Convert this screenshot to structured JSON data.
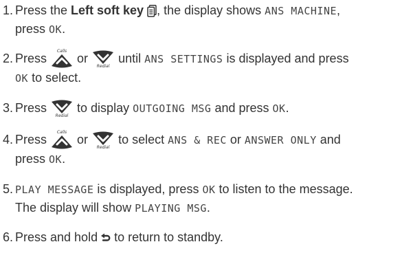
{
  "steps": [
    {
      "num": "1.",
      "t1": "Press the ",
      "bold": "Left soft key",
      "t2": ", the display shows ",
      "lcd1": "ANS MACHINE",
      "t3": ",",
      "t4": "press ",
      "lcd2": "OK",
      "t5": ".",
      "icon": "phonebook-soft-key-icon"
    },
    {
      "num": "2.",
      "t1": "Press ",
      "t2": " or ",
      "t3": " until ",
      "lcd1": "ANS SETTINGS",
      "t4": " is displayed and press",
      "lcd2": "OK",
      "t5": " to select.",
      "icons": [
        "calls-up-icon",
        "redial-down-icon"
      ]
    },
    {
      "num": "3.",
      "t1": "Press ",
      "t2": " to display ",
      "lcd1": "OUTGOING MSG",
      "t3": " and press ",
      "lcd2": "OK",
      "t4": ".",
      "icon": "redial-down-icon"
    },
    {
      "num": "4.",
      "t1": "Press ",
      "t2": " or ",
      "t3": " to select ",
      "lcd1": "ANS & REC",
      "t4": " or ",
      "lcd2": "ANSWER ONLY",
      "t5": " and",
      "t6": "press ",
      "lcd3": "OK",
      "t7": ".",
      "icons": [
        "calls-up-icon",
        "redial-down-icon"
      ]
    },
    {
      "num": "5.",
      "lcd1": "PLAY MESSAGE",
      "t1": " is displayed, press ",
      "lcd2": "OK",
      "t2": " to listen to the message.",
      "t3": "The display will show ",
      "lcd3": "PLAYING MSG",
      "t4": "."
    },
    {
      "num": "6.",
      "t1": "Press and hold ",
      "t2": " to return to standby.",
      "icon": "back-arrow-icon"
    }
  ],
  "icon_labels": {
    "calls": "Calls",
    "redial": "Redial"
  },
  "colors": {
    "text": "#333333",
    "icon": "#333333"
  }
}
